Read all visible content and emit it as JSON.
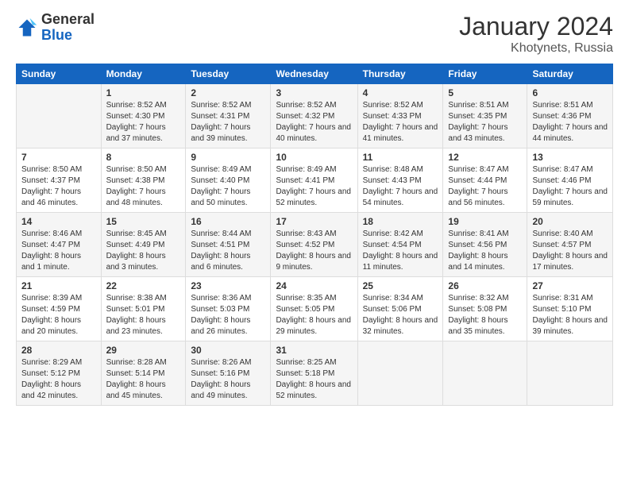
{
  "logo": {
    "general": "General",
    "blue": "Blue"
  },
  "header": {
    "month": "January 2024",
    "location": "Khotynets, Russia"
  },
  "days_of_week": [
    "Sunday",
    "Monday",
    "Tuesday",
    "Wednesday",
    "Thursday",
    "Friday",
    "Saturday"
  ],
  "weeks": [
    [
      {
        "day": "",
        "sunrise": "",
        "sunset": "",
        "daylight": ""
      },
      {
        "day": "1",
        "sunrise": "Sunrise: 8:52 AM",
        "sunset": "Sunset: 4:30 PM",
        "daylight": "Daylight: 7 hours and 37 minutes."
      },
      {
        "day": "2",
        "sunrise": "Sunrise: 8:52 AM",
        "sunset": "Sunset: 4:31 PM",
        "daylight": "Daylight: 7 hours and 39 minutes."
      },
      {
        "day": "3",
        "sunrise": "Sunrise: 8:52 AM",
        "sunset": "Sunset: 4:32 PM",
        "daylight": "Daylight: 7 hours and 40 minutes."
      },
      {
        "day": "4",
        "sunrise": "Sunrise: 8:52 AM",
        "sunset": "Sunset: 4:33 PM",
        "daylight": "Daylight: 7 hours and 41 minutes."
      },
      {
        "day": "5",
        "sunrise": "Sunrise: 8:51 AM",
        "sunset": "Sunset: 4:35 PM",
        "daylight": "Daylight: 7 hours and 43 minutes."
      },
      {
        "day": "6",
        "sunrise": "Sunrise: 8:51 AM",
        "sunset": "Sunset: 4:36 PM",
        "daylight": "Daylight: 7 hours and 44 minutes."
      }
    ],
    [
      {
        "day": "7",
        "sunrise": "Sunrise: 8:50 AM",
        "sunset": "Sunset: 4:37 PM",
        "daylight": "Daylight: 7 hours and 46 minutes."
      },
      {
        "day": "8",
        "sunrise": "Sunrise: 8:50 AM",
        "sunset": "Sunset: 4:38 PM",
        "daylight": "Daylight: 7 hours and 48 minutes."
      },
      {
        "day": "9",
        "sunrise": "Sunrise: 8:49 AM",
        "sunset": "Sunset: 4:40 PM",
        "daylight": "Daylight: 7 hours and 50 minutes."
      },
      {
        "day": "10",
        "sunrise": "Sunrise: 8:49 AM",
        "sunset": "Sunset: 4:41 PM",
        "daylight": "Daylight: 7 hours and 52 minutes."
      },
      {
        "day": "11",
        "sunrise": "Sunrise: 8:48 AM",
        "sunset": "Sunset: 4:43 PM",
        "daylight": "Daylight: 7 hours and 54 minutes."
      },
      {
        "day": "12",
        "sunrise": "Sunrise: 8:47 AM",
        "sunset": "Sunset: 4:44 PM",
        "daylight": "Daylight: 7 hours and 56 minutes."
      },
      {
        "day": "13",
        "sunrise": "Sunrise: 8:47 AM",
        "sunset": "Sunset: 4:46 PM",
        "daylight": "Daylight: 7 hours and 59 minutes."
      }
    ],
    [
      {
        "day": "14",
        "sunrise": "Sunrise: 8:46 AM",
        "sunset": "Sunset: 4:47 PM",
        "daylight": "Daylight: 8 hours and 1 minute."
      },
      {
        "day": "15",
        "sunrise": "Sunrise: 8:45 AM",
        "sunset": "Sunset: 4:49 PM",
        "daylight": "Daylight: 8 hours and 3 minutes."
      },
      {
        "day": "16",
        "sunrise": "Sunrise: 8:44 AM",
        "sunset": "Sunset: 4:51 PM",
        "daylight": "Daylight: 8 hours and 6 minutes."
      },
      {
        "day": "17",
        "sunrise": "Sunrise: 8:43 AM",
        "sunset": "Sunset: 4:52 PM",
        "daylight": "Daylight: 8 hours and 9 minutes."
      },
      {
        "day": "18",
        "sunrise": "Sunrise: 8:42 AM",
        "sunset": "Sunset: 4:54 PM",
        "daylight": "Daylight: 8 hours and 11 minutes."
      },
      {
        "day": "19",
        "sunrise": "Sunrise: 8:41 AM",
        "sunset": "Sunset: 4:56 PM",
        "daylight": "Daylight: 8 hours and 14 minutes."
      },
      {
        "day": "20",
        "sunrise": "Sunrise: 8:40 AM",
        "sunset": "Sunset: 4:57 PM",
        "daylight": "Daylight: 8 hours and 17 minutes."
      }
    ],
    [
      {
        "day": "21",
        "sunrise": "Sunrise: 8:39 AM",
        "sunset": "Sunset: 4:59 PM",
        "daylight": "Daylight: 8 hours and 20 minutes."
      },
      {
        "day": "22",
        "sunrise": "Sunrise: 8:38 AM",
        "sunset": "Sunset: 5:01 PM",
        "daylight": "Daylight: 8 hours and 23 minutes."
      },
      {
        "day": "23",
        "sunrise": "Sunrise: 8:36 AM",
        "sunset": "Sunset: 5:03 PM",
        "daylight": "Daylight: 8 hours and 26 minutes."
      },
      {
        "day": "24",
        "sunrise": "Sunrise: 8:35 AM",
        "sunset": "Sunset: 5:05 PM",
        "daylight": "Daylight: 8 hours and 29 minutes."
      },
      {
        "day": "25",
        "sunrise": "Sunrise: 8:34 AM",
        "sunset": "Sunset: 5:06 PM",
        "daylight": "Daylight: 8 hours and 32 minutes."
      },
      {
        "day": "26",
        "sunrise": "Sunrise: 8:32 AM",
        "sunset": "Sunset: 5:08 PM",
        "daylight": "Daylight: 8 hours and 35 minutes."
      },
      {
        "day": "27",
        "sunrise": "Sunrise: 8:31 AM",
        "sunset": "Sunset: 5:10 PM",
        "daylight": "Daylight: 8 hours and 39 minutes."
      }
    ],
    [
      {
        "day": "28",
        "sunrise": "Sunrise: 8:29 AM",
        "sunset": "Sunset: 5:12 PM",
        "daylight": "Daylight: 8 hours and 42 minutes."
      },
      {
        "day": "29",
        "sunrise": "Sunrise: 8:28 AM",
        "sunset": "Sunset: 5:14 PM",
        "daylight": "Daylight: 8 hours and 45 minutes."
      },
      {
        "day": "30",
        "sunrise": "Sunrise: 8:26 AM",
        "sunset": "Sunset: 5:16 PM",
        "daylight": "Daylight: 8 hours and 49 minutes."
      },
      {
        "day": "31",
        "sunrise": "Sunrise: 8:25 AM",
        "sunset": "Sunset: 5:18 PM",
        "daylight": "Daylight: 8 hours and 52 minutes."
      },
      {
        "day": "",
        "sunrise": "",
        "sunset": "",
        "daylight": ""
      },
      {
        "day": "",
        "sunrise": "",
        "sunset": "",
        "daylight": ""
      },
      {
        "day": "",
        "sunrise": "",
        "sunset": "",
        "daylight": ""
      }
    ]
  ]
}
